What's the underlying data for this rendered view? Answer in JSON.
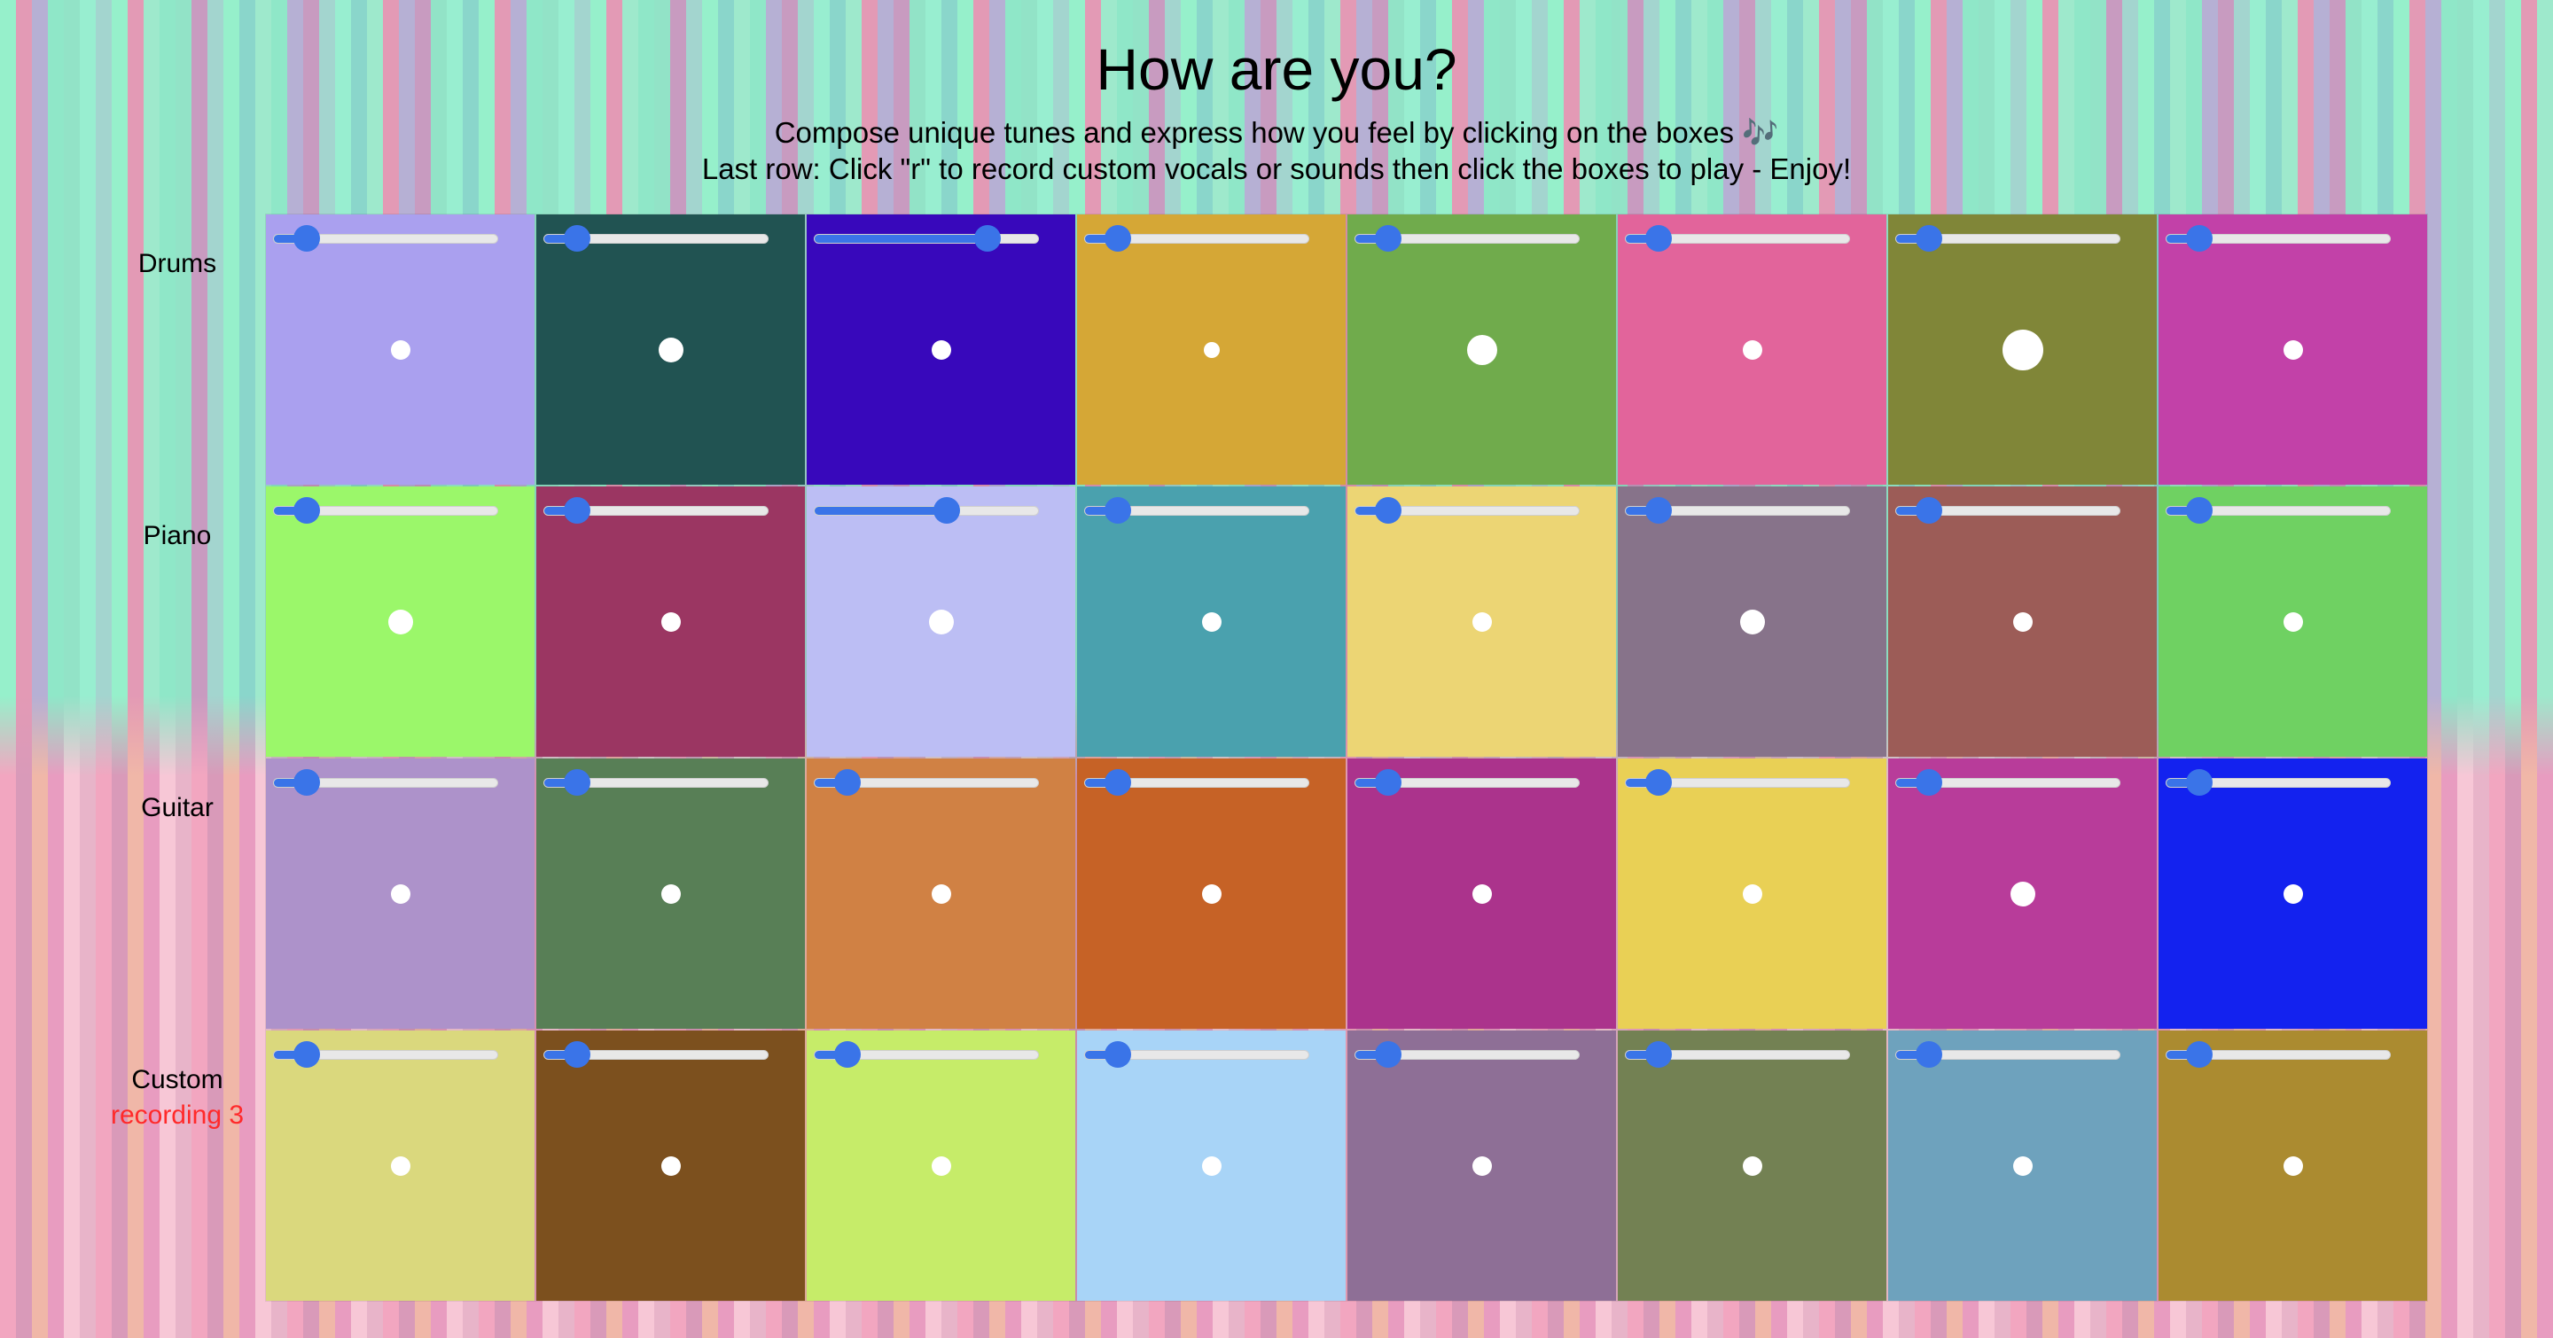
{
  "header": {
    "title": "How are you?",
    "subtitle_1": "Compose unique tunes and express how you feel by clicking on the boxes 🎶",
    "subtitle_2": "Last row: Click \"r\" to record custom vocals or sounds then click the boxes to play - Enjoy!"
  },
  "recording_status": "recording 3",
  "rows": [
    {
      "label": "Drums",
      "cells": [
        {
          "color": "#aaa0ef",
          "slider": 0.15,
          "dot_size": "small"
        },
        {
          "color": "#215352",
          "slider": 0.15,
          "dot_size": "medium"
        },
        {
          "color": "#3808bb",
          "slider": 0.77,
          "dot_size": "small"
        },
        {
          "color": "#d5a736",
          "slider": 0.15,
          "dot_size": "tiny"
        },
        {
          "color": "#70ab4c",
          "slider": 0.15,
          "dot_size": "large"
        },
        {
          "color": "#e2649b",
          "slider": 0.15,
          "dot_size": "small"
        },
        {
          "color": "#808638",
          "slider": 0.15,
          "dot_size": "xlarge"
        },
        {
          "color": "#c241a8",
          "slider": 0.15,
          "dot_size": "small"
        }
      ]
    },
    {
      "label": "Piano",
      "cells": [
        {
          "color": "#9bf76a",
          "slider": 0.15,
          "dot_size": "medium"
        },
        {
          "color": "#9b3662",
          "slider": 0.15,
          "dot_size": "small"
        },
        {
          "color": "#bcbef4",
          "slider": 0.59,
          "dot_size": "medium"
        },
        {
          "color": "#4aa1ae",
          "slider": 0.15,
          "dot_size": "small"
        },
        {
          "color": "#ecd574",
          "slider": 0.15,
          "dot_size": "small"
        },
        {
          "color": "#87738a",
          "slider": 0.15,
          "dot_size": "medium"
        },
        {
          "color": "#9c5c57",
          "slider": 0.15,
          "dot_size": "small"
        },
        {
          "color": "#6fd162",
          "slider": 0.15,
          "dot_size": "small"
        }
      ]
    },
    {
      "label": "Guitar",
      "cells": [
        {
          "color": "#ad92ca",
          "slider": 0.15,
          "dot_size": "small"
        },
        {
          "color": "#587f56",
          "slider": 0.15,
          "dot_size": "small"
        },
        {
          "color": "#d08144",
          "slider": 0.15,
          "dot_size": "small"
        },
        {
          "color": "#c66226",
          "slider": 0.15,
          "dot_size": "small"
        },
        {
          "color": "#ab338c",
          "slider": 0.15,
          "dot_size": "small"
        },
        {
          "color": "#e9d055",
          "slider": 0.15,
          "dot_size": "small"
        },
        {
          "color": "#b83c9a",
          "slider": 0.15,
          "dot_size": "medium"
        },
        {
          "color": "#1322ef",
          "slider": 0.15,
          "dot_size": "small"
        }
      ]
    },
    {
      "label": "Custom",
      "cells": [
        {
          "color": "#dad87d",
          "slider": 0.15,
          "dot_size": "small"
        },
        {
          "color": "#7c501e",
          "slider": 0.15,
          "dot_size": "small"
        },
        {
          "color": "#c6ec69",
          "slider": 0.15,
          "dot_size": "small"
        },
        {
          "color": "#a8d4f7",
          "slider": 0.15,
          "dot_size": "small"
        },
        {
          "color": "#8e6f96",
          "slider": 0.15,
          "dot_size": "small"
        },
        {
          "color": "#738153",
          "slider": 0.15,
          "dot_size": "small"
        },
        {
          "color": "#6ea2bd",
          "slider": 0.15,
          "dot_size": "small"
        },
        {
          "color": "#ab8b30",
          "slider": 0.15,
          "dot_size": "small"
        }
      ]
    }
  ],
  "theme": {
    "background": "#96f0cb",
    "slider_accent": "#3a74e8",
    "recording_color": "#ff2a2a"
  }
}
